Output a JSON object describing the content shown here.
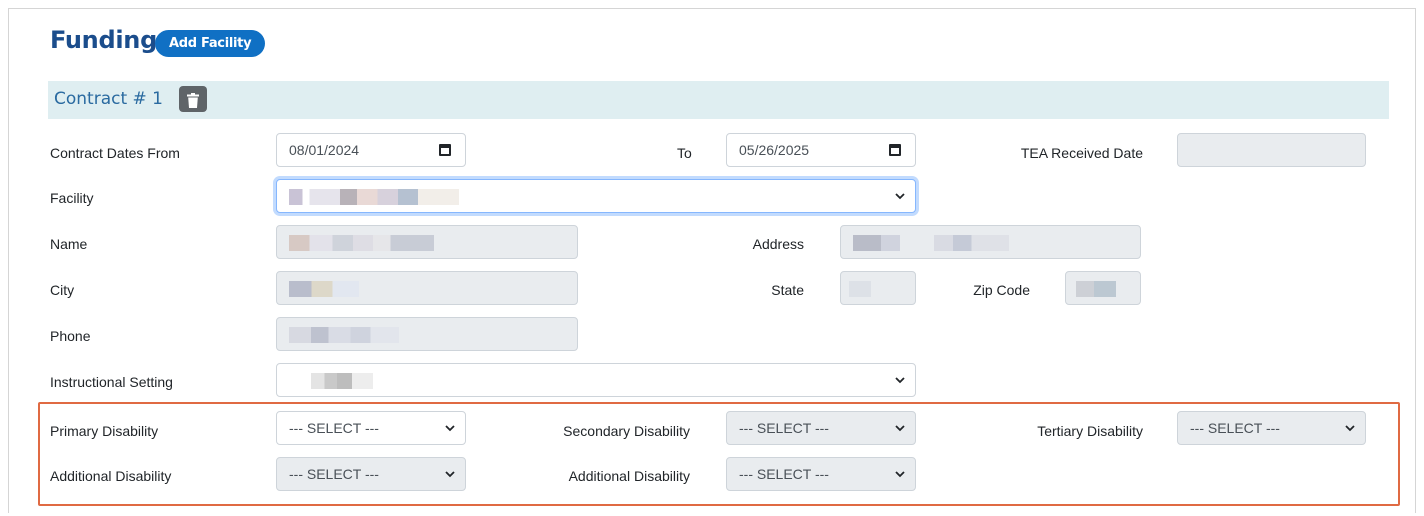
{
  "header": {
    "title": "Funding",
    "add_facility_label": "Add Facility"
  },
  "contract": {
    "title": "Contract # 1"
  },
  "labels": {
    "contract_dates_from": "Contract Dates From",
    "to": "To",
    "tea_received_date": "TEA Received Date",
    "facility": "Facility",
    "name": "Name",
    "address": "Address",
    "city": "City",
    "state": "State",
    "zip_code": "Zip Code",
    "phone": "Phone",
    "instructional_setting": "Instructional Setting",
    "primary_disability": "Primary Disability",
    "secondary_disability": "Secondary Disability",
    "tertiary_disability": "Tertiary Disability",
    "additional_disability_1": "Additional Disability",
    "additional_disability_2": "Additional Disability"
  },
  "values": {
    "date_from": "08/01/2024",
    "date_to": "05/26/2025",
    "tea_received_date": "",
    "primary_disability": "--- SELECT ---",
    "secondary_disability": "--- SELECT ---",
    "tertiary_disability": "--- SELECT ---",
    "additional_disability_1": "--- SELECT ---",
    "additional_disability_2": "--- SELECT ---"
  },
  "colors": {
    "title": "#1b4d8c",
    "add_button": "#1070c4",
    "contract_bar": "#dfeef1",
    "highlight_border": "#e06a43",
    "disabled_field": "#e9ecef"
  },
  "icons": {
    "trash": "trash-icon",
    "calendar": "calendar-icon",
    "dropdown": "chevron-down-icon"
  }
}
